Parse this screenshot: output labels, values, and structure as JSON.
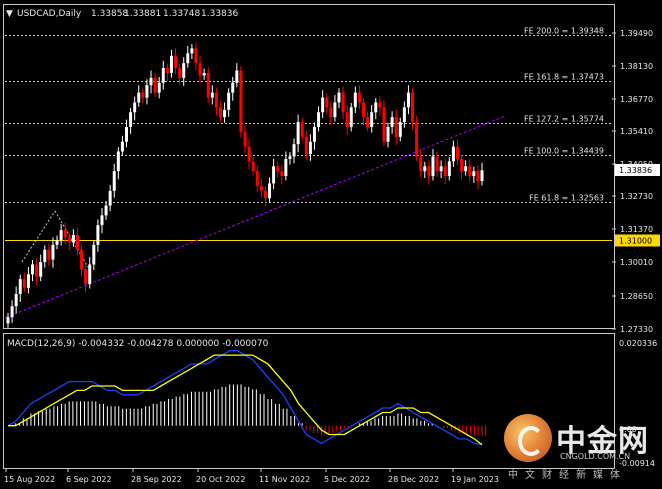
{
  "header": {
    "symbol": "USDCAD,Daily",
    "open": "1.33858",
    "high": "1.33881",
    "low": "1.33748",
    "close": "1.33836"
  },
  "colors": {
    "bg": "#000000",
    "bull": "#ffffff",
    "bear": "#ff0000",
    "frame": "#c8c8c8",
    "trend": "#b000ff",
    "level": "#ffd700",
    "macd": "#1d3fff",
    "signal": "#ffff00"
  },
  "price_axis": {
    "ticks": [
      "1.39490",
      "1.38130",
      "1.36770",
      "1.35410",
      "1.34050",
      "1.32730",
      "1.31370",
      "1.30010",
      "1.28650",
      "1.27330"
    ],
    "current_price_label": "1.33836",
    "level_label": "1.31000"
  },
  "fib_levels": [
    {
      "label": "FE 200.0 = 1.39348",
      "price": 1.39348
    },
    {
      "label": "FE 161.8 = 1.37473",
      "price": 1.37473
    },
    {
      "label": "FE 127.2 = 1.35774",
      "price": 1.35774
    },
    {
      "label": "FE 100.0 = 1.34439",
      "price": 1.34439
    },
    {
      "label": "FE 61.8 = 1.32563",
      "price": 1.32563
    }
  ],
  "horizontal_level": 1.31,
  "time_axis": [
    "15 Aug 2022",
    "6 Sep 2022",
    "28 Sep 2022",
    "20 Oct 2022",
    "11 Nov 2022",
    "5 Dec 2022",
    "28 Dec 2022",
    "19 Jan 2023"
  ],
  "macd_panel": {
    "title": "MACD(12,26,9) -0.004332 -0.004278 0.000000 -0.000070",
    "ticks": [
      "0.020336",
      "0.00"
    ],
    "bottom_label": "-0.00914"
  },
  "watermark": {
    "cn": "中金网",
    "en": "CNGOLD.COM.CN",
    "tagline": "中文财经新媒体"
  },
  "chart_data": {
    "type": "candlestick",
    "title": "USDCAD,Daily",
    "series": [
      {
        "name": "USDCAD",
        "close": [
          1.2785,
          1.283,
          1.288,
          1.294,
          1.2905,
          1.296,
          1.3,
          1.295,
          1.301,
          1.306,
          1.302,
          1.308,
          1.31,
          1.314,
          1.311,
          1.309,
          1.312,
          1.306,
          1.298,
          1.292,
          1.3,
          1.308,
          1.316,
          1.32,
          1.324,
          1.33,
          1.338,
          1.346,
          1.35,
          1.356,
          1.362,
          1.366,
          1.37,
          1.368,
          1.373,
          1.376,
          1.37,
          1.374,
          1.38,
          1.378,
          1.385,
          1.38,
          1.376,
          1.382,
          1.386,
          1.388,
          1.382,
          1.377,
          1.378,
          1.368,
          1.37,
          1.364,
          1.36,
          1.363,
          1.37,
          1.374,
          1.379,
          1.354,
          1.348,
          1.342,
          1.338,
          1.332,
          1.33,
          1.327,
          1.333,
          1.34,
          1.338,
          1.336,
          1.343,
          1.344,
          1.349,
          1.358,
          1.352,
          1.345,
          1.35,
          1.356,
          1.362,
          1.368,
          1.364,
          1.36,
          1.366,
          1.37,
          1.362,
          1.356,
          1.364,
          1.37,
          1.366,
          1.36,
          1.356,
          1.362,
          1.366,
          1.364,
          1.35,
          1.356,
          1.36,
          1.352,
          1.358,
          1.364,
          1.37,
          1.358,
          1.344,
          1.338,
          1.34,
          1.336,
          1.344,
          1.338,
          1.34,
          1.336,
          1.342,
          1.348,
          1.343,
          1.338,
          1.34,
          1.336,
          1.338,
          1.334,
          1.33836
        ]
      }
    ],
    "x_ticks": [
      "15 Aug 2022",
      "6 Sep 2022",
      "28 Sep 2022",
      "20 Oct 2022",
      "11 Nov 2022",
      "5 Dec 2022",
      "28 Dec 2022",
      "19 Jan 2023"
    ],
    "ylim": [
      1.2733,
      1.4019
    ],
    "macd": {
      "macd": [
        0.0,
        0.001,
        0.003,
        0.005,
        0.006,
        0.007,
        0.008,
        0.009,
        0.01,
        0.01,
        0.01,
        0.01,
        0.009,
        0.008,
        0.008,
        0.007,
        0.007,
        0.007,
        0.008,
        0.009,
        0.01,
        0.011,
        0.012,
        0.013,
        0.014,
        0.014,
        0.014,
        0.015,
        0.016,
        0.017,
        0.017,
        0.016,
        0.015,
        0.013,
        0.011,
        0.009,
        0.007,
        0.004,
        0.001,
        -0.002,
        -0.003,
        -0.004,
        -0.003,
        -0.002,
        -0.001,
        0.0,
        0.001,
        0.002,
        0.003,
        0.004,
        0.004,
        0.005,
        0.004,
        0.003,
        0.002,
        0.001,
        0.0,
        -0.001,
        -0.002,
        -0.003,
        -0.003,
        -0.004,
        -0.0043
      ],
      "signal": [
        0.0,
        0.0,
        0.001,
        0.002,
        0.003,
        0.004,
        0.005,
        0.006,
        0.007,
        0.008,
        0.008,
        0.009,
        0.009,
        0.009,
        0.009,
        0.008,
        0.008,
        0.008,
        0.008,
        0.008,
        0.009,
        0.01,
        0.011,
        0.012,
        0.013,
        0.014,
        0.015,
        0.016,
        0.016,
        0.016,
        0.016,
        0.016,
        0.016,
        0.015,
        0.014,
        0.012,
        0.01,
        0.008,
        0.005,
        0.003,
        0.001,
        -0.001,
        -0.002,
        -0.002,
        -0.002,
        -0.001,
        0.0,
        0.001,
        0.002,
        0.003,
        0.003,
        0.004,
        0.004,
        0.004,
        0.003,
        0.003,
        0.002,
        0.001,
        0.0,
        -0.001,
        -0.002,
        -0.003,
        -0.0043
      ],
      "histogram_note": "white bars above zero, red bars below zero",
      "ylim": [
        -0.00914,
        0.020336
      ]
    }
  }
}
